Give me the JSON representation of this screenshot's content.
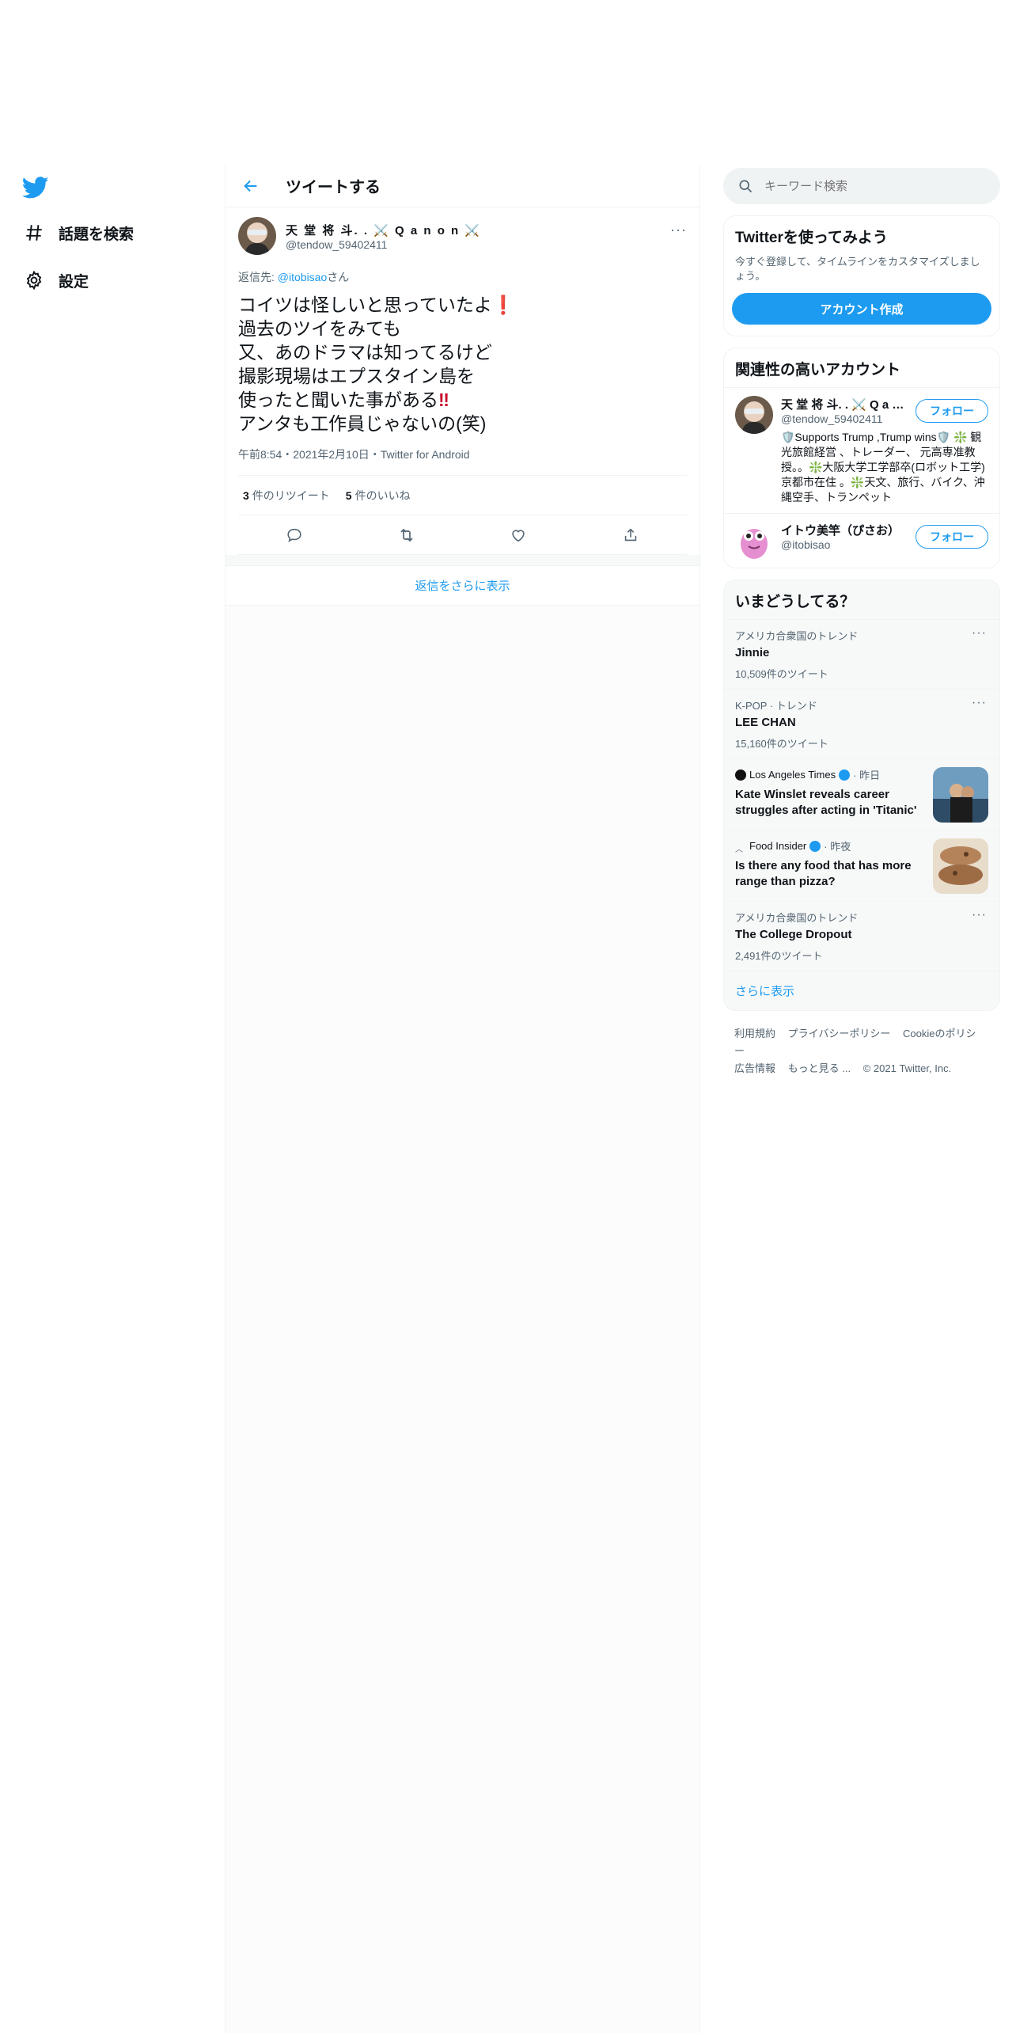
{
  "nav": {
    "explore_label": "話題を検索",
    "settings_label": "設定"
  },
  "header": {
    "title": "ツイートする"
  },
  "tweet": {
    "display_name": "天 堂 将 斗. . ⚔️ Q a n o n ⚔️",
    "username": "@tendow_59402411",
    "reply_prefix": "返信先: ",
    "reply_handle": "@itobisao",
    "reply_suffix": "さん",
    "lines": [
      "コイツは怪しいと思っていたよ",
      "過去のツイをみても",
      "又、あのドラマは知ってるけど",
      "撮影現場はエプスタイン島を",
      "使ったと聞いた事がある",
      "アンタも工作員じゃないの(笑)"
    ],
    "exclaim_single": "❗",
    "exclaim_double": "‼",
    "meta": "午前8:54・2021年2月10日・Twitter for Android",
    "retweets_count": "3",
    "retweets_label": "件のリツイート",
    "likes_count": "5",
    "likes_label": "件のいいね",
    "more": "···",
    "show_more_replies": "返信をさらに表示"
  },
  "search": {
    "placeholder": "キーワード検索"
  },
  "signup": {
    "title": "Twitterを使ってみよう",
    "desc": "今すぐ登録して、タイムラインをカスタマイズしましょう。",
    "button": "アカウント作成"
  },
  "relevant": {
    "title": "関連性の高いアカウント",
    "accounts": [
      {
        "display_name": "天 堂 将 斗. . ⚔️ Q a n o n ⚔️",
        "username": "@tendow_59402411",
        "bio": "🛡️Supports Trump ,Trump wins🛡️ ❇️ 観光旅館経営 、トレーダー、 元高専准教授。。❇️大阪大学工学部卒(ロボット工学) 京都市在住 。❇️天文、旅行、バイク、沖縄空手、トランペット",
        "follow": "フォロー"
      },
      {
        "display_name": "イトウ美竿（ぴさお）",
        "username": "@itobisao",
        "bio": "",
        "follow": "フォロー"
      }
    ]
  },
  "trends": {
    "title": "いまどうしてる？",
    "items": [
      {
        "context": "アメリカ合衆国のトレンド",
        "name": "Jinnie",
        "count": "10,509件のツイート"
      },
      {
        "context": "K-POP · トレンド",
        "name": "LEE CHAN",
        "count": "15,160件のツイート"
      }
    ],
    "news": [
      {
        "source": "Los Angeles Times",
        "time": "· 昨日",
        "headline": "Kate Winslet reveals career struggles after acting in 'Titanic'"
      },
      {
        "source": "Food Insider",
        "time": "· 昨夜",
        "headline": "Is there any food that has more range than pizza?"
      }
    ],
    "last": {
      "context": "アメリカ合衆国のトレンド",
      "name": "The College Dropout",
      "count": "2,491件のツイート"
    },
    "show_more": "さらに表示",
    "more": "···"
  },
  "footer": {
    "links": [
      "利用規約",
      "プライバシーポリシー",
      "Cookieのポリシー",
      "広告情報",
      "もっと見る ...",
      "© 2021 Twitter, Inc."
    ]
  },
  "colors": {
    "accent": "#1d9bf0",
    "text": "#0f1419",
    "muted": "#536471"
  }
}
